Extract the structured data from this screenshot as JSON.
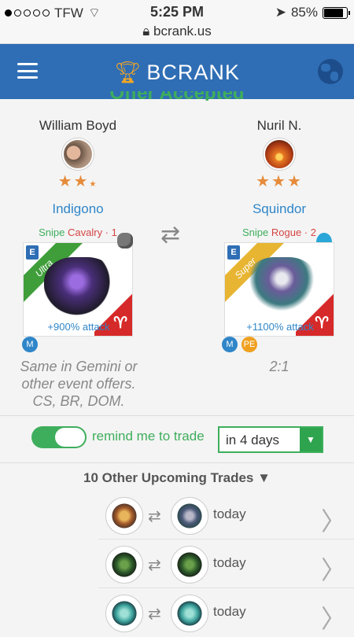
{
  "status_bar": {
    "carrier": "TFW",
    "time": "5:25 PM",
    "battery": "85%",
    "battery_level": 0.85,
    "url": "bcrank.us"
  },
  "header": {
    "brand": "BCRANK"
  },
  "headline": "Offer Accepted",
  "left": {
    "user": "William Boyd",
    "stars": "★★",
    "monster": "Indigono",
    "snipe": "Snipe",
    "class_tag": "Cavalry · 1",
    "rarity": "Ultra",
    "bonus": "+900% attack",
    "badges": [
      "M"
    ],
    "note": "Same in Gemini or other event offers. CS, BR, DOM."
  },
  "right": {
    "user": "Nuril N.",
    "stars": "★★★",
    "monster": "Squindor",
    "snipe": "Snipe",
    "class_tag": "Rogue · 2",
    "rarity": "Super",
    "bonus": "+1100% attack",
    "badges": [
      "M",
      "PE"
    ],
    "note": "2:1"
  },
  "reminder": {
    "label": "remind me to trade",
    "enabled": true,
    "select_value": "in 4 days"
  },
  "upcoming": {
    "title": "10 Other Upcoming Trades ▼",
    "trades": [
      {
        "when": "today"
      },
      {
        "when": "today"
      },
      {
        "when": "today"
      }
    ]
  },
  "icons": {
    "menu": "hamburger-icon",
    "globe": "globe-icon",
    "swap": "swap-arrows-icon",
    "chevron": "chevron-right-icon"
  },
  "colors": {
    "header": "#2f6db4",
    "green": "#3fae5c",
    "blue": "#2f86c9",
    "red": "#d64545",
    "star": "#e58b3a"
  }
}
